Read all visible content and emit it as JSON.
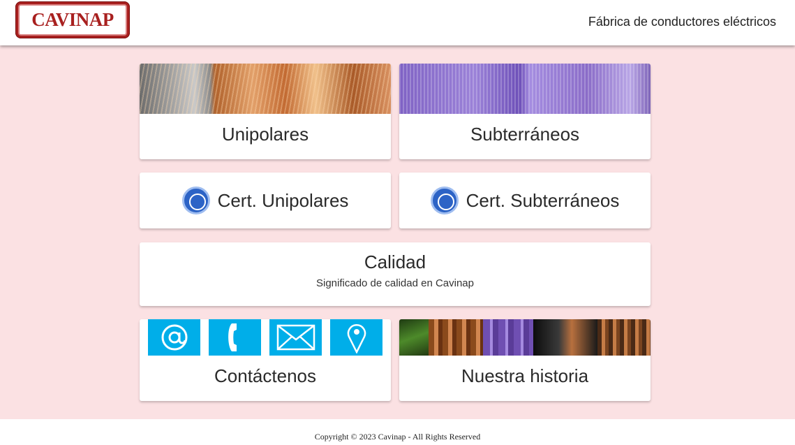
{
  "header": {
    "logo_text": "CAVINAP",
    "tagline": "Fábrica de conductores eléctricos"
  },
  "cards": {
    "unipolares": {
      "title": "Unipolares",
      "image_icon": "copper-cable-image"
    },
    "subterraneos": {
      "title": "Subterráneos",
      "image_icon": "purple-cable-image"
    },
    "cert_unipolares": {
      "title": "Cert. Unipolares",
      "icon": "iram-seal-icon"
    },
    "cert_subterraneos": {
      "title": "Cert. Subterráneos",
      "icon": "iram-seal-icon"
    },
    "calidad": {
      "title": "Calidad",
      "subtitle": "Significado de calidad en Cavinap"
    },
    "contactenos": {
      "title": "Contáctenos",
      "icons": [
        "at-sign-icon",
        "phone-icon",
        "envelope-icon",
        "location-pin-icon"
      ]
    },
    "historia": {
      "title": "Nuestra historia",
      "image_icon": "factory-collage-image"
    }
  },
  "colors": {
    "background": "#fbe1e3",
    "brand_red": "#a8201f",
    "contact_blue": "#00aee9"
  },
  "footer": {
    "copyright": "Copyright © 2023 Cavinap - All Rights Reserved"
  }
}
